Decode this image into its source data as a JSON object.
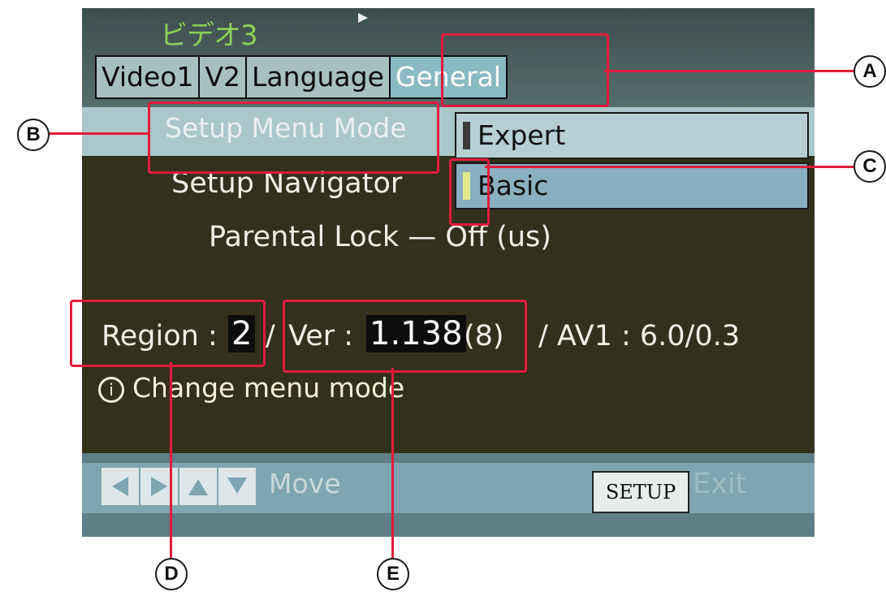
{
  "osd": {
    "title": "ビデオ3",
    "tabs": [
      {
        "label": "Video1",
        "active": false
      },
      {
        "label": "V2",
        "active": false
      },
      {
        "label": "Language",
        "active": false
      },
      {
        "label": "General",
        "active": true
      }
    ],
    "setup_menu_mode_label": "Setup Menu Mode",
    "setup_navigator_label": "Setup Navigator",
    "parental_lock_text": "Parental Lock — Off (us)",
    "options": [
      {
        "label": "Expert",
        "selected": false
      },
      {
        "label": "Basic",
        "selected": true
      }
    ],
    "region_label": "Region :",
    "region_value": "2",
    "ver_separator": "/",
    "ver_label": "Ver :",
    "ver_value": "1.138",
    "ver_suffix": "(8)",
    "av_text": "/ AV1 : 6.0/0.3",
    "hint_icon": "info-icon",
    "hint_text": "Change menu mode",
    "nav_icons": [
      "arrow-left-icon",
      "arrow-right-icon",
      "arrow-up-icon",
      "arrow-down-icon"
    ],
    "move_label": "Move",
    "setup_button": "SETUP",
    "exit_label": "Exit"
  },
  "callouts": {
    "a": "A",
    "b": "B",
    "c": "C",
    "d": "D",
    "e": "E"
  },
  "colors": {
    "callout_red": "#e21b3c",
    "osd_background": "#33301c",
    "selected_option": "#89afc0",
    "title_green": "#8ccf57"
  }
}
